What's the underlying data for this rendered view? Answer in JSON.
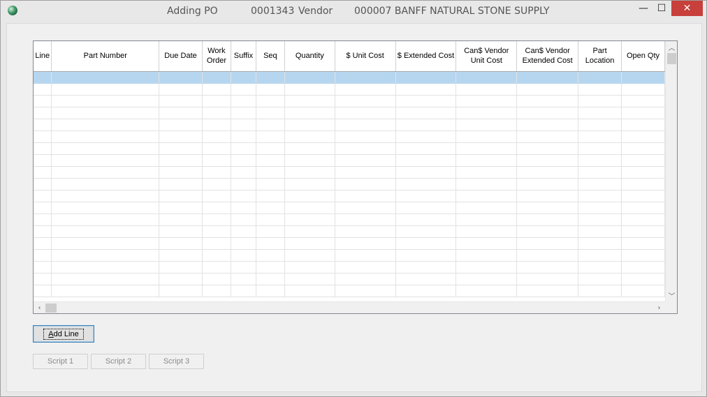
{
  "window": {
    "title_action": "Adding PO",
    "po_number": "0001343",
    "vendor_label": "Vendor",
    "vendor_value": "000007 BANFF NATURAL STONE SUPPLY",
    "minimize_glyph": "—",
    "maximize_glyph": "☐",
    "close_glyph": "✕",
    "icon": "app-globe-icon"
  },
  "grid": {
    "columns": [
      {
        "line1": "Line",
        "line2": ""
      },
      {
        "line1": "Part Number",
        "line2": ""
      },
      {
        "line1": "Due Date",
        "line2": ""
      },
      {
        "line1": "Work",
        "line2": "Order"
      },
      {
        "line1": "Suffix",
        "line2": ""
      },
      {
        "line1": "Seq",
        "line2": ""
      },
      {
        "line1": "Quantity",
        "line2": ""
      },
      {
        "line1": "$ Unit Cost",
        "line2": ""
      },
      {
        "line1": "$ Extended Cost",
        "line2": ""
      },
      {
        "line1": "Can$ Vendor",
        "line2": "Unit Cost"
      },
      {
        "line1": "Can$ Vendor",
        "line2": "Extended Cost"
      },
      {
        "line1": "Part",
        "line2": "Location"
      },
      {
        "line1": "Open Qty",
        "line2": ""
      }
    ],
    "row_count": 19,
    "selected_row": 0,
    "selected_color": "#b6d6f0"
  },
  "buttons": {
    "add_line_prefix": "A",
    "add_line_rest": "dd Line",
    "script1": "Script 1",
    "script2": "Script 2",
    "script3": "Script 3"
  }
}
